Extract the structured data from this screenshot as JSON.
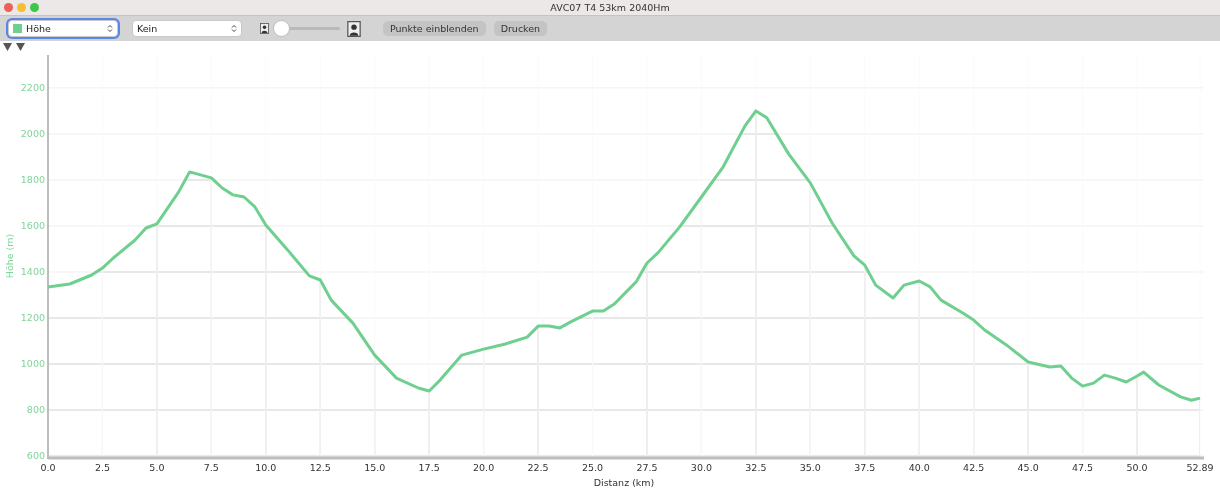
{
  "window": {
    "title": "AVC07 T4 53km 2040Hm"
  },
  "toolbar": {
    "selects": [
      {
        "value": "Höhe",
        "focused": true,
        "color": "#6fcf8e"
      },
      {
        "value": "Kein",
        "focused": false
      }
    ],
    "slider": {
      "level": 0
    },
    "buttons": [
      "Punkte einblenden",
      "Drucken"
    ]
  },
  "chart": {
    "chart_data": {
      "type": "line",
      "xlabel": "Distanz (km)",
      "ylabel": "Höhe (m)",
      "x": [
        0,
        1,
        2,
        2.5,
        3,
        4,
        4.5,
        5,
        6,
        6.5,
        7.5,
        8,
        8.5,
        9,
        9.5,
        10,
        11,
        12,
        12.5,
        13,
        14,
        15,
        16,
        17,
        17.5,
        18,
        19,
        20,
        21,
        22,
        22.5,
        23,
        23.5,
        24,
        25,
        25.5,
        26,
        27,
        27.5,
        28,
        29,
        30,
        31,
        32,
        32.5,
        33,
        34,
        35,
        36,
        37,
        37.5,
        38,
        38.8,
        39.3,
        40,
        40.5,
        41,
        42,
        42.5,
        43,
        44,
        45,
        46,
        46.5,
        47,
        47.5,
        48,
        48.5,
        49,
        49.5,
        50,
        50.3,
        51,
        52,
        52.5,
        52.89
      ],
      "series": [
        {
          "color": "#6fcf8e",
          "values": [
            1335,
            1348,
            1387,
            1417,
            1461,
            1539,
            1591,
            1609,
            1748,
            1835,
            1809,
            1765,
            1735,
            1726,
            1683,
            1604,
            1496,
            1383,
            1365,
            1278,
            1178,
            1039,
            939,
            896,
            883,
            930,
            1039,
            1065,
            1087,
            1117,
            1165,
            1165,
            1157,
            1183,
            1230,
            1230,
            1261,
            1357,
            1439,
            1483,
            1596,
            1726,
            1857,
            2035,
            2100,
            2070,
            1913,
            1787,
            1613,
            1470,
            1430,
            1343,
            1287,
            1343,
            1361,
            1335,
            1278,
            1222,
            1191,
            1148,
            1083,
            1009,
            987,
            991,
            939,
            904,
            917,
            952,
            939,
            922,
            948,
            965,
            909,
            857,
            843,
            852
          ]
        }
      ],
      "grid": true,
      "xlim": [
        0,
        52.89
      ],
      "ylim": [
        596,
        2343
      ],
      "xticks": [
        {
          "value": 0,
          "label": "0.0"
        },
        {
          "value": 2.5,
          "label": "2.5"
        },
        {
          "value": 5,
          "label": "5.0"
        },
        {
          "value": 7.5,
          "label": "7.5"
        },
        {
          "value": 10,
          "label": "10.0"
        },
        {
          "value": 12.5,
          "label": "12.5"
        },
        {
          "value": 15,
          "label": "15.0"
        },
        {
          "value": 17.5,
          "label": "17.5"
        },
        {
          "value": 20,
          "label": "20.0"
        },
        {
          "value": 22.5,
          "label": "22.5"
        },
        {
          "value": 25,
          "label": "25.0"
        },
        {
          "value": 27.5,
          "label": "27.5"
        },
        {
          "value": 30,
          "label": "30.0"
        },
        {
          "value": 32.5,
          "label": "32.5"
        },
        {
          "value": 35,
          "label": "35.0"
        },
        {
          "value": 37.5,
          "label": "37.5"
        },
        {
          "value": 40,
          "label": "40.0"
        },
        {
          "value": 42.5,
          "label": "42.5"
        },
        {
          "value": 45,
          "label": "45.0"
        },
        {
          "value": 47.5,
          "label": "47.5"
        },
        {
          "value": 50,
          "label": "50.0"
        },
        {
          "value": 52.89,
          "label": "52.89"
        }
      ],
      "yticks": [
        600,
        800,
        1000,
        1200,
        1400,
        1600,
        1800,
        2000,
        2200
      ]
    }
  }
}
